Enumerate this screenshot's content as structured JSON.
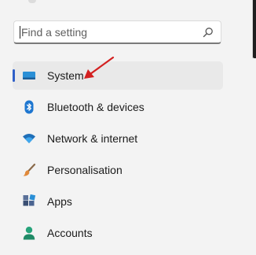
{
  "search": {
    "placeholder": "Find a setting",
    "value": "",
    "icon": "search-icon"
  },
  "nav": {
    "items": [
      {
        "label": "System",
        "icon": "system-icon",
        "selected": true
      },
      {
        "label": "Bluetooth & devices",
        "icon": "bluetooth-icon"
      },
      {
        "label": "Network & internet",
        "icon": "wifi-icon"
      },
      {
        "label": "Personalisation",
        "icon": "brush-icon"
      },
      {
        "label": "Apps",
        "icon": "apps-icon"
      },
      {
        "label": "Accounts",
        "icon": "accounts-icon"
      }
    ]
  },
  "colors": {
    "accent": "#2f5fc8",
    "annotation_arrow": "#d32020",
    "background": "#f3f3f3"
  }
}
